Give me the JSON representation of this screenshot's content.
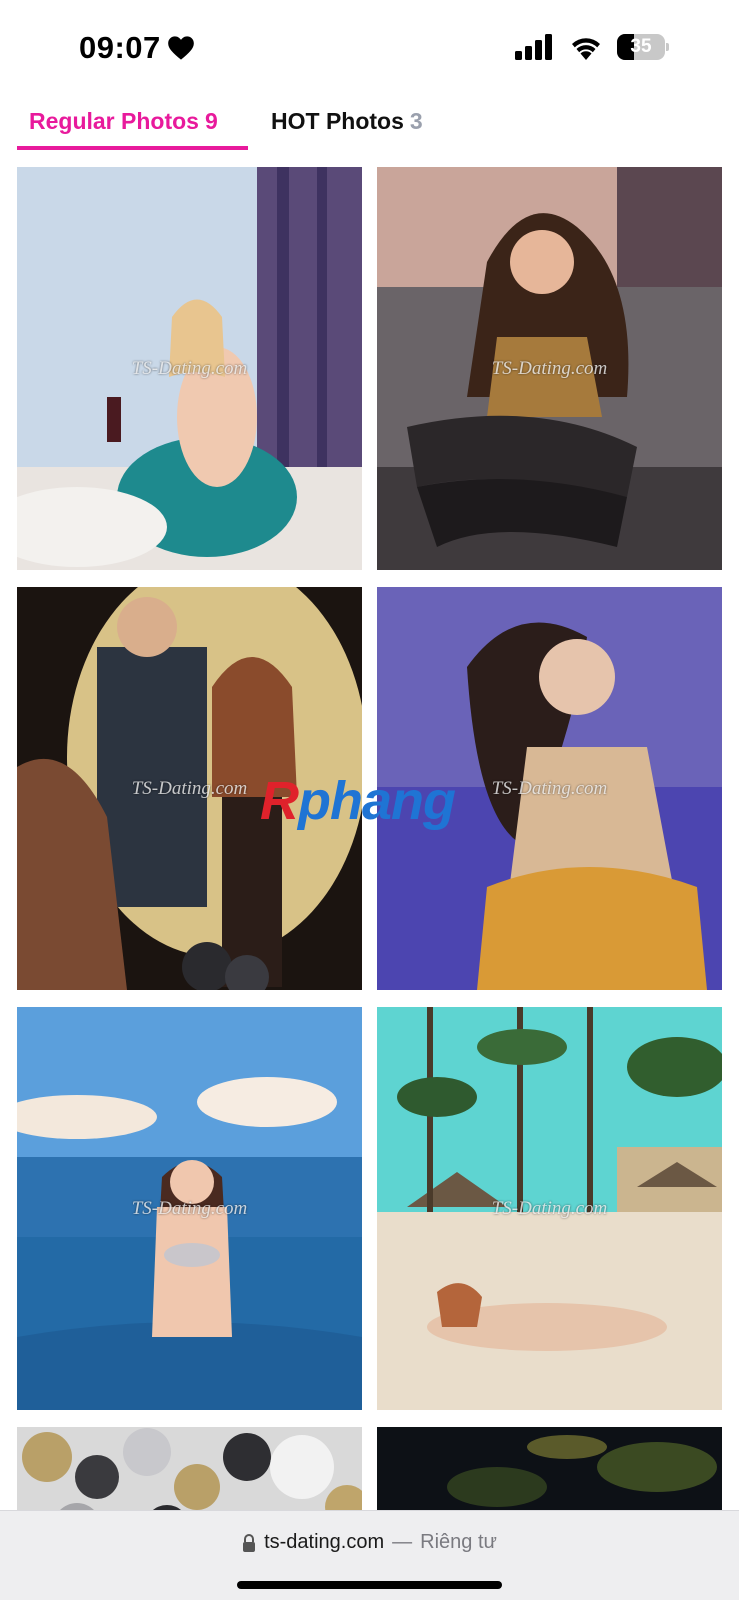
{
  "status_bar": {
    "time": "09:07",
    "battery_percent": "35",
    "battery_level": 0.35
  },
  "tabs": [
    {
      "label": "Regular Photos",
      "count": "9",
      "active": true
    },
    {
      "label": "HOT Photos",
      "count": "3",
      "active": false
    }
  ],
  "photos": {
    "watermark": "TS-Dating.com"
  },
  "overlay": {
    "logo_first": "R",
    "logo_rest": "phang"
  },
  "address_bar": {
    "domain": "ts-dating.com",
    "separator": "—",
    "privacy_label": "Riêng tư"
  },
  "colors": {
    "accent": "#e81a9c",
    "tab_inactive_count": "#9aa0ad",
    "logo_red": "#e0222b",
    "logo_blue": "#1f74d4"
  }
}
